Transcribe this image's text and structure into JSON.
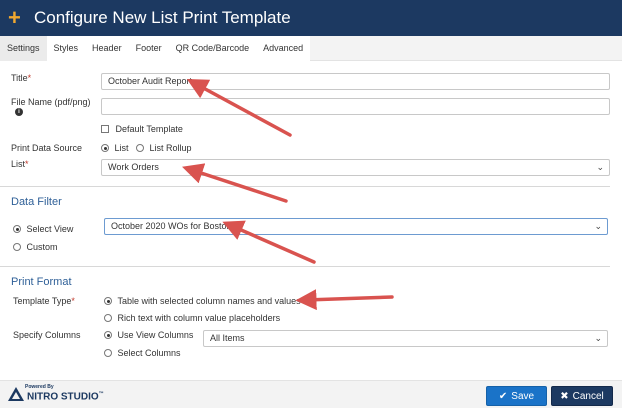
{
  "header": {
    "plus_icon": "plus-icon",
    "title": "Configure New List Print Template"
  },
  "tabs": [
    "Settings",
    "Styles",
    "Header",
    "Footer",
    "QR Code/Barcode",
    "Advanced"
  ],
  "settings": {
    "title_label": "Title",
    "required_mark": "*",
    "title_value": "October Audit Report",
    "file_name_label": "File Name (pdf/png)",
    "file_name_info_icon": "info-icon",
    "file_name_value": "",
    "default_template_label": "Default Template",
    "print_data_source_label": "Print Data Source",
    "source_list": "List",
    "source_list_rollup": "List Rollup",
    "list_label": "List",
    "list_value": "Work Orders"
  },
  "data_filter": {
    "heading": "Data Filter",
    "select_view": "Select View",
    "custom": "Custom",
    "view_value": "October 2020 WOs for Boston"
  },
  "print_format": {
    "heading": "Print Format",
    "template_type_label": "Template Type",
    "option_table": "Table with selected column names and values",
    "option_rich_text": "Rich text with column value placeholders",
    "specify_columns_label": "Specify Columns",
    "use_view_columns": "Use View Columns",
    "select_columns": "Select Columns",
    "columns_value": "All Items"
  },
  "footer": {
    "logo_small": "Powered By",
    "logo_brand": "NITRO STUDIO",
    "logo_tm": "™",
    "save_label": "Save",
    "cancel_label": "Cancel"
  },
  "colors": {
    "header_bg": "#1c3961",
    "accent": "#f0a830",
    "section_title": "#2e5f97",
    "save_bg": "#1a73c8",
    "arrow": "#d9534f"
  }
}
